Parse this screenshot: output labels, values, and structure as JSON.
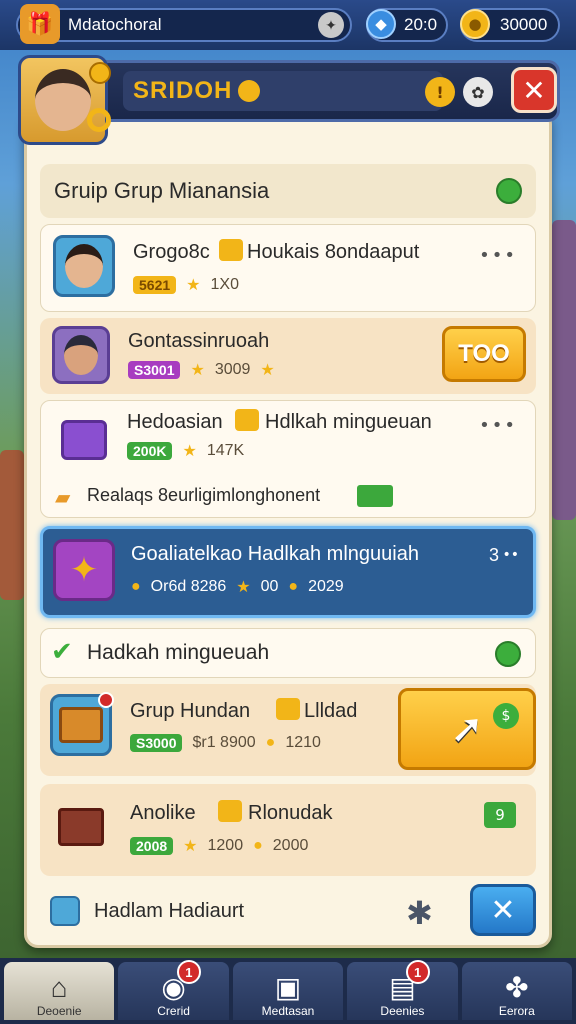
{
  "topbar": {
    "player_name": "Mdatochoral",
    "gems": "20:0",
    "coins": "30000"
  },
  "header": {
    "title": "SRIDOH"
  },
  "section1": {
    "title": "Gruip Grup Mianansia"
  },
  "rows": [
    {
      "name": "Grogo8c",
      "name2": "Houkais 8ondaaput",
      "tag": "5621",
      "stat": "1X0"
    },
    {
      "name": "Gontassinruoah",
      "tag": "S3001",
      "stat": "3009",
      "button": "TOO"
    },
    {
      "name": "Hedoasian",
      "name2": "Hdlkah mingueuan",
      "tag": "200K",
      "stat": "147K",
      "note": "Realaqs 8eurligimlonghonent"
    },
    {
      "name": "Goaliatelkao Hadlkah mlnguuiah",
      "stat1": "Or6d 8286",
      "stat2": "00",
      "stat3": "2029",
      "badge": "3"
    }
  ],
  "section2": {
    "title": "Hadkah mingueuah"
  },
  "rows2": [
    {
      "name": "Grup Hundan",
      "name2": "Llldad",
      "tag": "S3000",
      "stat1": "$r1 8900",
      "stat2": "1210"
    },
    {
      "name": "Anolike",
      "name2": "Rlonudak",
      "tag": "2008",
      "stat1": "1200",
      "stat2": "2000",
      "side": "9"
    }
  ],
  "footer": {
    "label": "Hadlam Hadiaurt"
  },
  "nav": [
    {
      "label": "Deoenie",
      "icon": "home-icon"
    },
    {
      "label": "Crerid",
      "icon": "chat-icon",
      "badge": "1"
    },
    {
      "label": "Medtasan",
      "icon": "bag-icon"
    },
    {
      "label": "Deenies",
      "icon": "card-icon",
      "badge": "1"
    },
    {
      "label": "Eerora",
      "icon": "grid-icon"
    }
  ],
  "colors": {
    "accent": "#f2a414",
    "highlight_row": "#2c5d93",
    "close": "#d9362b"
  }
}
